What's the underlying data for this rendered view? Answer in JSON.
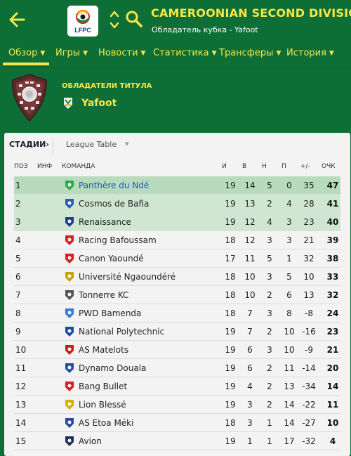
{
  "header": {
    "title": "CAMEROONIAN SECOND DIVISION",
    "subtitle": "Обладатель кубка - Yafoot",
    "logo_text": "LFPC"
  },
  "nav": {
    "items": [
      {
        "label": "Обзор"
      },
      {
        "label": "Игры"
      },
      {
        "label": "Новости"
      },
      {
        "label": "Статистика"
      },
      {
        "label": "Трансферы"
      },
      {
        "label": "История"
      }
    ],
    "active_index": 0
  },
  "holder": {
    "label": "ОБЛАДАТЕЛИ ТИТУЛА",
    "name": "Yafoot"
  },
  "panel": {
    "stage_label": "СТАДИИ",
    "stage_chevron": "›",
    "league_select": "League Table"
  },
  "table": {
    "headers": {
      "pos": "ПОЗ",
      "inf": "ИНФ",
      "team": "КОМАНДА",
      "p": "И",
      "w": "В",
      "d": "Н",
      "l": "П",
      "gd": "+/-",
      "pts": "ОЧК"
    },
    "rows": [
      {
        "pos": "1",
        "team": "Panthère du Ndé",
        "p": "19",
        "w": "14",
        "d": "5",
        "l": "0",
        "gd": "35",
        "pts": "47"
      },
      {
        "pos": "2",
        "team": "Cosmos de Bafia",
        "p": "19",
        "w": "13",
        "d": "2",
        "l": "4",
        "gd": "28",
        "pts": "41"
      },
      {
        "pos": "3",
        "team": "Renaissance",
        "p": "19",
        "w": "12",
        "d": "4",
        "l": "3",
        "gd": "23",
        "pts": "40"
      },
      {
        "pos": "4",
        "team": "Racing Bafoussam",
        "p": "18",
        "w": "12",
        "d": "3",
        "l": "3",
        "gd": "21",
        "pts": "39"
      },
      {
        "pos": "5",
        "team": "Canon Yaoundé",
        "p": "17",
        "w": "11",
        "d": "5",
        "l": "1",
        "gd": "32",
        "pts": "38"
      },
      {
        "pos": "6",
        "team": "Université Ngaoundéré",
        "p": "18",
        "w": "10",
        "d": "3",
        "l": "5",
        "gd": "10",
        "pts": "33"
      },
      {
        "pos": "7",
        "team": "Tonnerre KC",
        "p": "18",
        "w": "10",
        "d": "2",
        "l": "6",
        "gd": "13",
        "pts": "32"
      },
      {
        "pos": "8",
        "team": "PWD Bamenda",
        "p": "18",
        "w": "7",
        "d": "3",
        "l": "8",
        "gd": "-8",
        "pts": "24"
      },
      {
        "pos": "9",
        "team": "National Polytechnic",
        "p": "19",
        "w": "7",
        "d": "2",
        "l": "10",
        "gd": "-16",
        "pts": "23"
      },
      {
        "pos": "10",
        "team": "AS Matelots",
        "p": "19",
        "w": "6",
        "d": "3",
        "l": "10",
        "gd": "-9",
        "pts": "21"
      },
      {
        "pos": "11",
        "team": "Dynamo Douala",
        "p": "19",
        "w": "6",
        "d": "2",
        "l": "11",
        "gd": "-14",
        "pts": "20"
      },
      {
        "pos": "12",
        "team": "Bang Bullet",
        "p": "19",
        "w": "4",
        "d": "2",
        "l": "13",
        "gd": "-34",
        "pts": "14"
      },
      {
        "pos": "13",
        "team": "Lion Blessé",
        "p": "19",
        "w": "3",
        "d": "2",
        "l": "14",
        "gd": "-22",
        "pts": "11"
      },
      {
        "pos": "14",
        "team": "AS Etoa Méki",
        "p": "18",
        "w": "3",
        "d": "1",
        "l": "14",
        "gd": "-27",
        "pts": "10"
      },
      {
        "pos": "15",
        "team": "Avion",
        "p": "19",
        "w": "1",
        "d": "1",
        "l": "17",
        "gd": "-32",
        "pts": "4"
      }
    ]
  },
  "colors": {
    "background": "#0d6f35",
    "accent": "#f7e64a",
    "promotion_row_1": "#b9dbbd",
    "promotion_row_2": "#cfe6d1",
    "link_team": "#2255aa"
  }
}
